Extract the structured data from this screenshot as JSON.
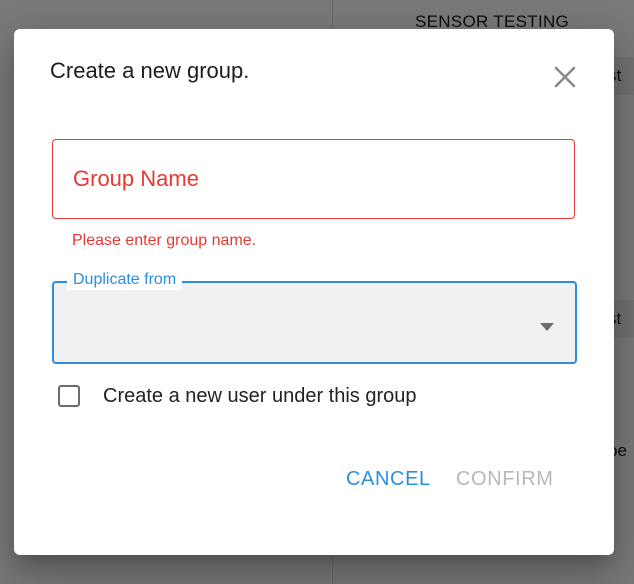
{
  "background": {
    "header_text": "SENSOR TESTING",
    "edge_texts": [
      "st",
      "st",
      "be"
    ]
  },
  "dialog": {
    "title": "Create a new group.",
    "close_icon": "close-icon",
    "group_name": {
      "placeholder": "Group Name",
      "value": "",
      "error": "Please enter group name."
    },
    "duplicate_from": {
      "label": "Duplicate from",
      "selected": "",
      "arrow_icon": "dropdown-arrow-icon"
    },
    "create_user_checkbox": {
      "label": "Create a new user under this group",
      "checked": false
    },
    "actions": {
      "cancel_label": "CANCEL",
      "confirm_label": "CONFIRM",
      "confirm_disabled": true
    }
  },
  "colors": {
    "accent": "#2b8fe0",
    "error": "#e53935",
    "disabled": "#b8b8b8"
  }
}
